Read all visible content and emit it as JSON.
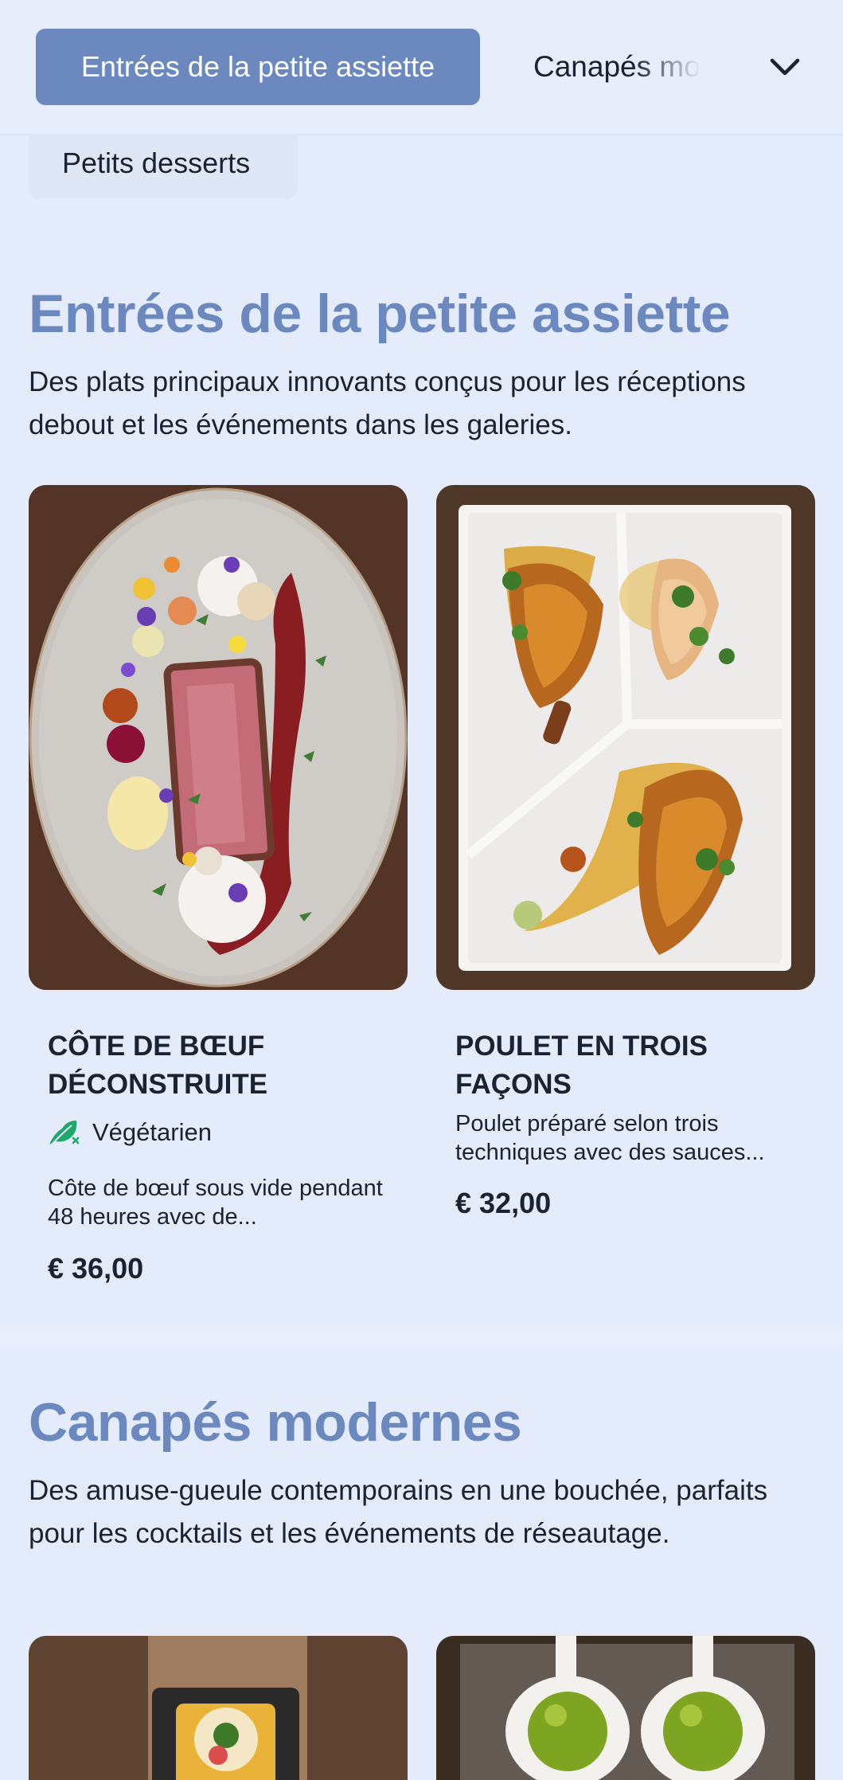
{
  "nav": {
    "active_category": "Entrées de la petite assiette",
    "next_category": "Canapés modernes",
    "overflow_category": "Petits desserts",
    "expand_icon": "chevron-down-icon"
  },
  "sections": [
    {
      "title": "Entrées de la petite assiette",
      "description": "Des plats principaux innovants conçus pour les réceptions debout et les événements dans les galeries.",
      "items": [
        {
          "name": "CÔTE DE BŒUF DÉCONSTRUITE",
          "tag": "Végétarien",
          "tag_icon": "leaf-icon",
          "description": "Côte de bœuf sous vide pendant 48 heures avec de...",
          "price": "€ 36,00"
        },
        {
          "name": "POULET EN TROIS FAÇONS",
          "description": "Poulet préparé selon trois techniques avec des sauces...",
          "price": "€ 32,00"
        }
      ]
    },
    {
      "title": "Canapés modernes",
      "description": "Des amuse-gueule contemporains en une bouchée, parfaits pour les cocktails et les événements de réseautage."
    }
  ],
  "colors": {
    "accent": "#6b89bf",
    "background": "#e4ebfb",
    "text": "#1b2233",
    "tag_green": "#1fa86a"
  }
}
